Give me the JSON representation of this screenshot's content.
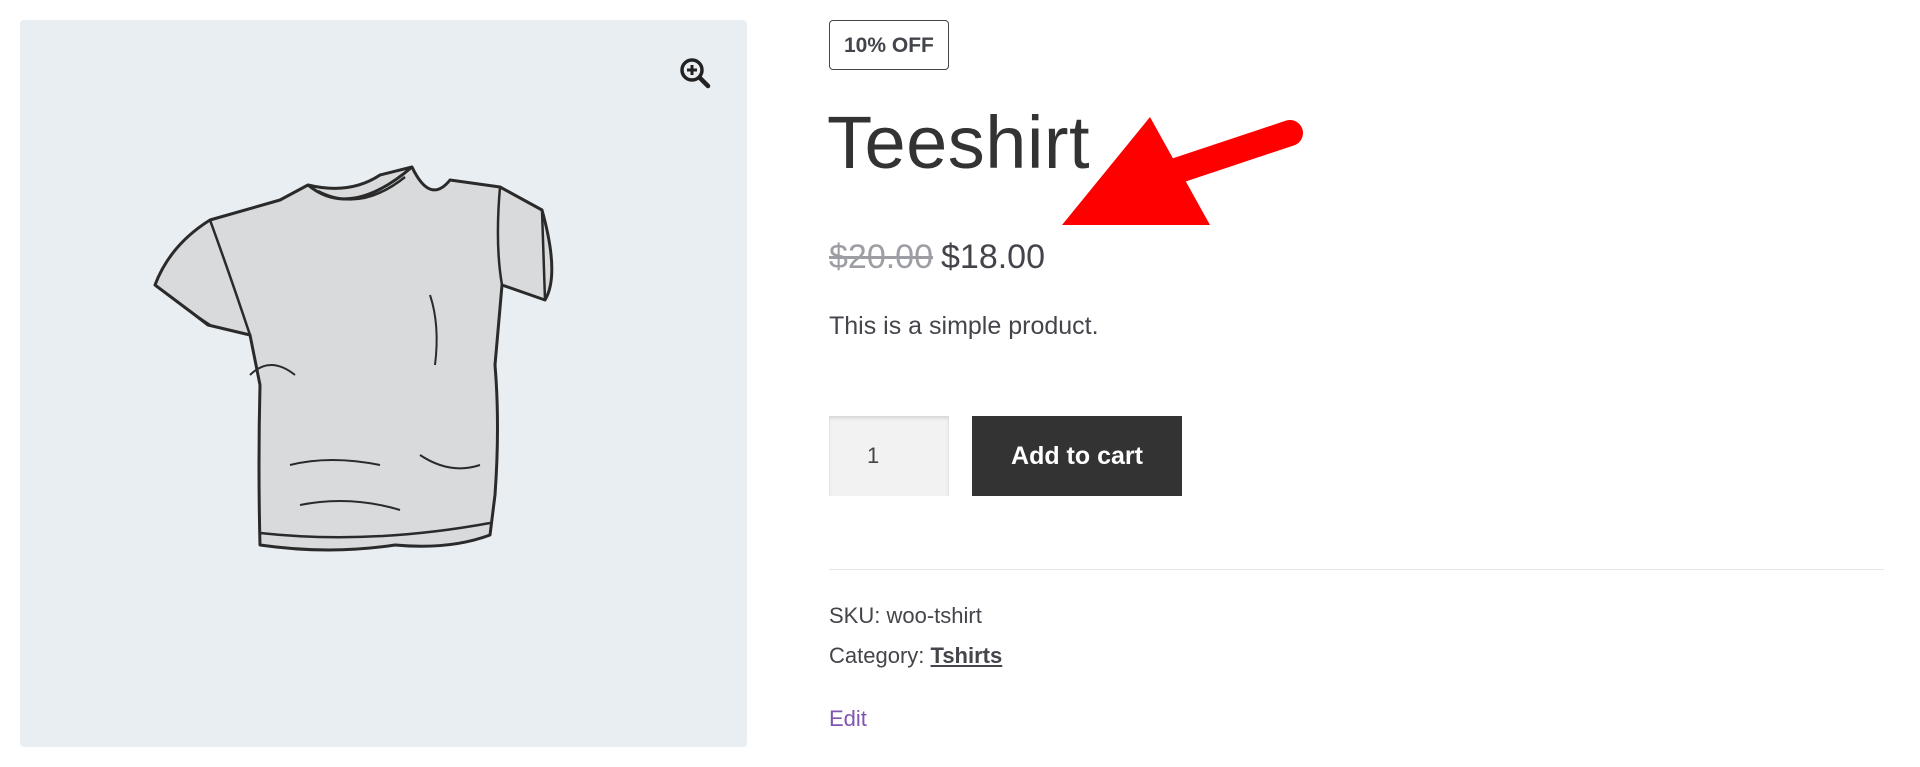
{
  "badge": {
    "label": "10% OFF"
  },
  "product": {
    "title": "Teeshirt",
    "regular_price": "$20.00",
    "sale_price": "$18.00",
    "description": "This is a simple product."
  },
  "cart": {
    "quantity": "1",
    "add_label": "Add to cart"
  },
  "meta": {
    "sku_label": "SKU:",
    "sku_value": "woo-tshirt",
    "category_label": "Category:",
    "category_value": "Tshirts"
  },
  "edit_label": "Edit",
  "icons": {
    "zoom": "zoom-in-icon",
    "annotation": "red-arrow"
  },
  "colors": {
    "gallery_bg": "#e9eef2",
    "button_bg": "#333333",
    "edit_link": "#7f54b3",
    "annotation_arrow": "#ff0000"
  }
}
